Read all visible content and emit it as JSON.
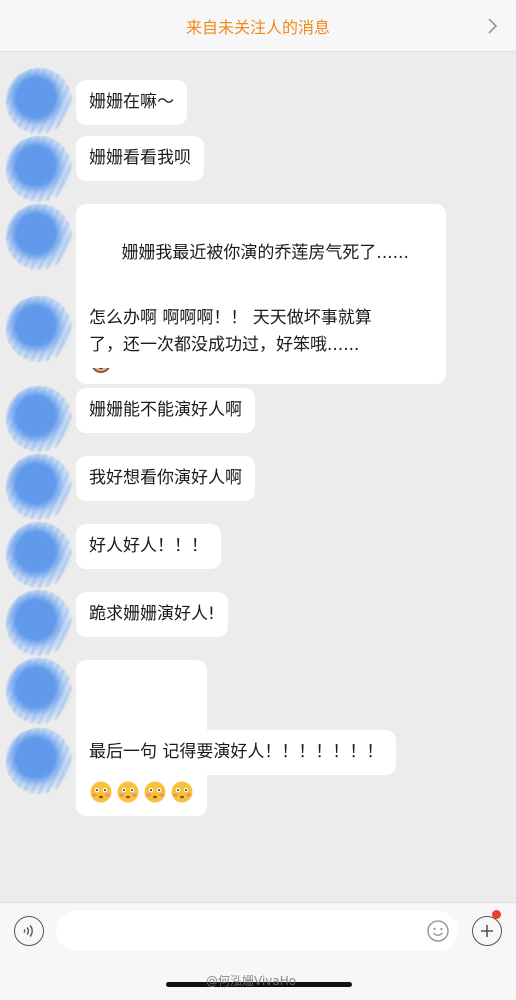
{
  "header": {
    "title": "来自未关注人的消息"
  },
  "messages": [
    {
      "text": "姗姗在嘛～"
    },
    {
      "text": "姗姗看看我呗"
    },
    {
      "text": "姗姗我最近被你演的乔莲房气死了......",
      "emoji": "see-no-evil-monkey"
    },
    {
      "text": "怎么办啊 啊啊啊！！ 天天做坏事就算\n了，还一次都没成功过，好笨哦......"
    },
    {
      "text": "姗姗能不能演好人啊"
    },
    {
      "text": "我好想看你演好人啊"
    },
    {
      "text": "好人好人！！！"
    },
    {
      "text": "跪求姗姗演好人!"
    },
    {
      "emoji_row": [
        "flushed-face",
        "flushed-face",
        "flushed-face",
        "flushed-face"
      ]
    },
    {
      "text": "最后一句 记得要演好人！！！！！！！"
    }
  ],
  "input": {
    "placeholder": ""
  },
  "watermark": "@何泓姗VivaHo",
  "colors": {
    "header_title": "#f08a1c",
    "background": "#ececec",
    "bubble": "#ffffff",
    "badge": "#e8402f"
  },
  "icons": {
    "header_right": "chevron-right-icon",
    "voice": "voice-icon",
    "emoji": "smiley-icon",
    "plus": "plus-icon"
  }
}
